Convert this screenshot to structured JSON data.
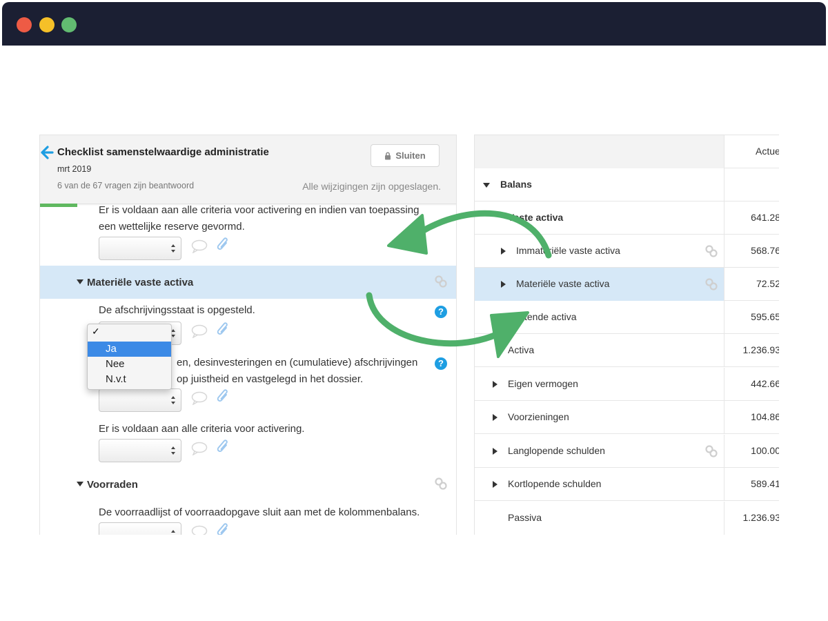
{
  "window": {
    "buttons": [
      "close",
      "minimize",
      "maximize"
    ]
  },
  "checklist": {
    "title": "Checklist samenstelwaardige administratie",
    "date": "mrt 2019",
    "progress_text": "6 van de 67 vragen zijn beantwoord",
    "saved_text": "Alle wijzigingen zijn opgeslagen.",
    "close_label": "Sluiten",
    "progress_fraction": 0.09
  },
  "questions": {
    "q0_line1": "Er is voldaan aan alle criteria voor activering en indien van toepassing",
    "q0_line2": "een wettelijke reserve gevormd.",
    "section1": "Materiële vaste activa",
    "q1": "De afschrijvingsstaat is opgesteld.",
    "q2_line1": "en, desinvesteringen en (cumulatieve) afschrijvingen",
    "q2_line2": "op juistheid en vastgelegd in het dossier.",
    "q3": "Er is voldaan aan alle criteria voor activering.",
    "section2": "Voorraden",
    "q4": "De voorraadlijst of voorraadopgave sluit aan met de kolommenbalans."
  },
  "dropdown": {
    "check": "✓",
    "options": [
      "Ja",
      "Nee",
      "N.v.t"
    ],
    "highlighted": "Ja"
  },
  "balance": {
    "column_header": "Actue",
    "rows": [
      {
        "label": "Balans",
        "value": ""
      },
      {
        "label": "Vaste activa",
        "value": "641.28"
      },
      {
        "label": "Immateriële vaste activa",
        "value": "568.76"
      },
      {
        "label": "Materiële vaste activa",
        "value": "72.52"
      },
      {
        "label": "tende activa",
        "value": "595.65"
      },
      {
        "label": "Activa",
        "value": "1.236.93"
      },
      {
        "label": "Eigen vermogen",
        "value": "442.66"
      },
      {
        "label": "Voorzieningen",
        "value": "104.86"
      },
      {
        "label": "Langlopende schulden",
        "value": "100.00"
      },
      {
        "label": "Kortlopende schulden",
        "value": "589.41"
      },
      {
        "label": "Passiva",
        "value": "1.236.93"
      }
    ]
  },
  "colors": {
    "accent": "#1e9ee2",
    "highlight": "#d6e8f7",
    "arrow": "#4fb06a",
    "titlebar": "#1b1f33"
  }
}
